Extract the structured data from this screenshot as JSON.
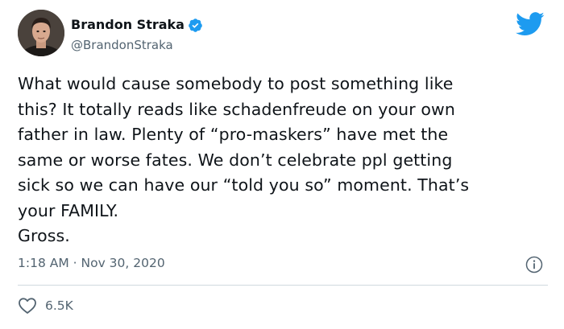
{
  "author": {
    "display_name": "Brandon Straka",
    "handle": "@BrandonStraka",
    "verified": true,
    "avatar_icon": "user-avatar-photo"
  },
  "platform": {
    "icon": "twitter-bird-icon",
    "brand_color": "#1d9bf0",
    "verified_color": "#1d9bf0"
  },
  "tweet": {
    "text": "What would cause somebody to post something like\nthis? It totally reads like schadenfreude on your own\nfather in law. Plenty of “pro-maskers” have met the\nsame or worse fates. We don’t celebrate ppl getting\nsick so we can have our “told you so” moment. That’s\nyour FAMILY.\nGross.",
    "timestamp": "1:18 AM · Nov 30, 2020"
  },
  "actions": {
    "like_icon": "heart-icon",
    "like_count": "6.5K",
    "info_icon": "info-icon"
  }
}
